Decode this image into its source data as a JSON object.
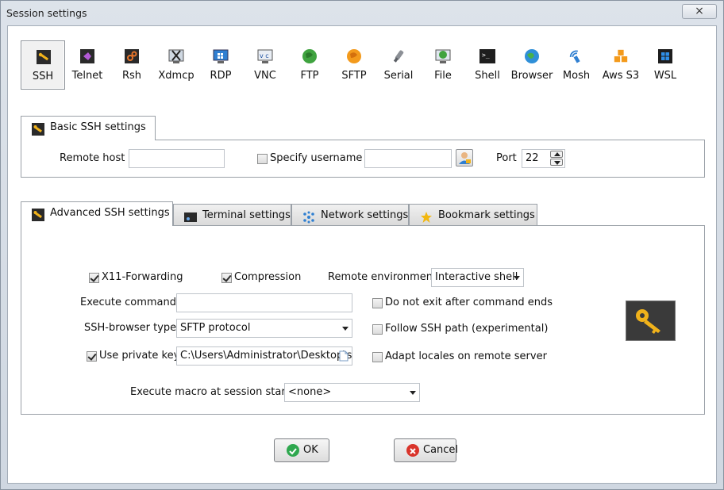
{
  "window": {
    "title": "Session settings",
    "close_icon": "×"
  },
  "session_types": [
    {
      "label": "SSH",
      "icon": "wrench-icon",
      "selected": true
    },
    {
      "label": "Telnet",
      "icon": "telnet-icon"
    },
    {
      "label": "Rsh",
      "icon": "rsh-icon"
    },
    {
      "label": "Xdmcp",
      "icon": "xdmcp-icon"
    },
    {
      "label": "RDP",
      "icon": "rdp-icon"
    },
    {
      "label": "VNC",
      "icon": "vnc-icon"
    },
    {
      "label": "FTP",
      "icon": "ftp-icon"
    },
    {
      "label": "SFTP",
      "icon": "sftp-icon"
    },
    {
      "label": "Serial",
      "icon": "serial-icon"
    },
    {
      "label": "File",
      "icon": "file-icon"
    },
    {
      "label": "Shell",
      "icon": "shell-icon"
    },
    {
      "label": "Browser",
      "icon": "browser-icon"
    },
    {
      "label": "Mosh",
      "icon": "mosh-icon"
    },
    {
      "label": "Aws S3",
      "icon": "aws-s3-icon"
    },
    {
      "label": "WSL",
      "icon": "wsl-icon"
    }
  ],
  "basic": {
    "tab_label": "Basic SSH settings",
    "remote_host_label": "Remote host *",
    "remote_host_value": "",
    "specify_username_label": "Specify username",
    "specify_username_checked": false,
    "username_value": "",
    "port_label": "Port",
    "port_value": "22"
  },
  "advanced_tabs": [
    {
      "label": "Advanced SSH settings",
      "icon": "wrench-icon",
      "active": true
    },
    {
      "label": "Terminal settings",
      "icon": "terminal-icon"
    },
    {
      "label": "Network settings",
      "icon": "network-icon"
    },
    {
      "label": "Bookmark settings",
      "icon": "star-icon"
    }
  ],
  "advanced": {
    "x11_label": "X11-Forwarding",
    "x11_checked": true,
    "compression_label": "Compression",
    "compression_checked": true,
    "remote_env_label": "Remote environment:",
    "remote_env_value": "Interactive shell",
    "execute_command_label": "Execute command:",
    "execute_command_value": "",
    "do_not_exit_label": "Do not exit after command ends",
    "do_not_exit_checked": false,
    "ssh_browser_label": "SSH-browser type:",
    "ssh_browser_value": "SFTP protocol",
    "follow_path_label": "Follow SSH path (experimental)",
    "follow_path_checked": false,
    "use_private_key_label": "Use private key",
    "use_private_key_checked": true,
    "private_key_value": "C:\\Users\\Administrator\\Desktop\\sc",
    "adapt_locales_label": "Adapt locales on remote server",
    "adapt_locales_checked": false,
    "macro_label": "Execute macro at session start:",
    "macro_value": "<none>"
  },
  "buttons": {
    "ok": "OK",
    "cancel": "Cancel"
  },
  "colors": {
    "ok_green": "#2fa84f",
    "cancel_red": "#d9342b",
    "key_gold": "#f0b21b",
    "key_bg": "#3a3a3a"
  }
}
